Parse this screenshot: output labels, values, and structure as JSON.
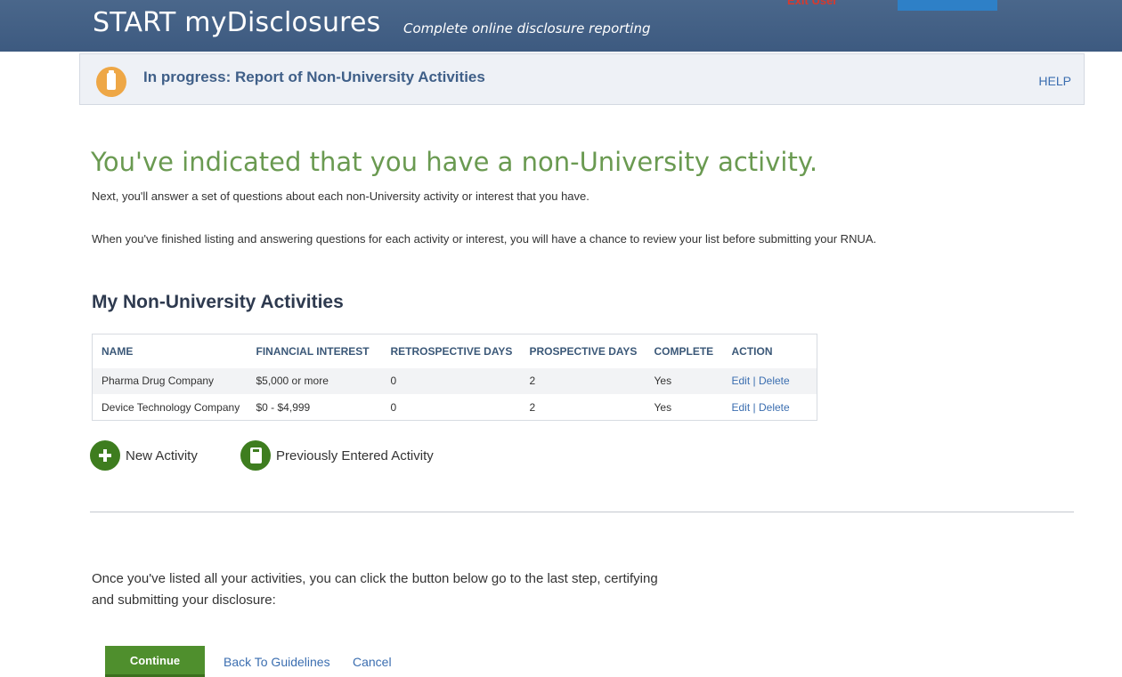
{
  "header": {
    "app_title": "START myDisclosures",
    "tagline": "Complete online disclosure reporting",
    "exit_label": "Exit User"
  },
  "banner": {
    "status_text": "In progress: Report of Non-University Activities",
    "help_label": "HELP",
    "icon": "document-icon"
  },
  "main": {
    "headline": "You've indicated that you have a non-University activity.",
    "intro_1": "Next, you'll answer a set of questions about each non-University activity or interest that you have.",
    "intro_2": "When you've finished listing and answering questions for each activity or interest, you will have a chance to review your list before submitting your RNUA."
  },
  "activities": {
    "section_title": "My Non-University Activities",
    "columns": [
      "NAME",
      "FINANCIAL INTEREST",
      "RETROSPECTIVE DAYS",
      "PROSPECTIVE DAYS",
      "COMPLETE",
      "ACTION"
    ],
    "rows": [
      {
        "name": "Pharma Drug Company",
        "financial_interest": "$5,000 or more",
        "retrospective_days": "0",
        "prospective_days": "2",
        "complete": "Yes",
        "edit_label": "Edit",
        "delete_label": "Delete"
      },
      {
        "name": "Device Technology Company",
        "financial_interest": "$0 - $4,999",
        "retrospective_days": "0",
        "prospective_days": "2",
        "complete": "Yes",
        "edit_label": "Edit",
        "delete_label": "Delete"
      }
    ],
    "new_activity_label": "New Activity",
    "previous_activity_label": "Previously Entered Activity"
  },
  "footer": {
    "closing_text": "Once you've listed all your activities, you can click the button below go to the last step, certifying and submitting your disclosure:",
    "continue_label": "Continue",
    "back_label": "Back To Guidelines",
    "cancel_label": "Cancel"
  },
  "colors": {
    "header_bg": "#3d5a80",
    "headline_green": "#6a9a51",
    "button_green": "#4f8f2d",
    "icon_green": "#3e7d1f",
    "link_blue": "#3b6eb0",
    "badge_orange": "#eea746"
  }
}
